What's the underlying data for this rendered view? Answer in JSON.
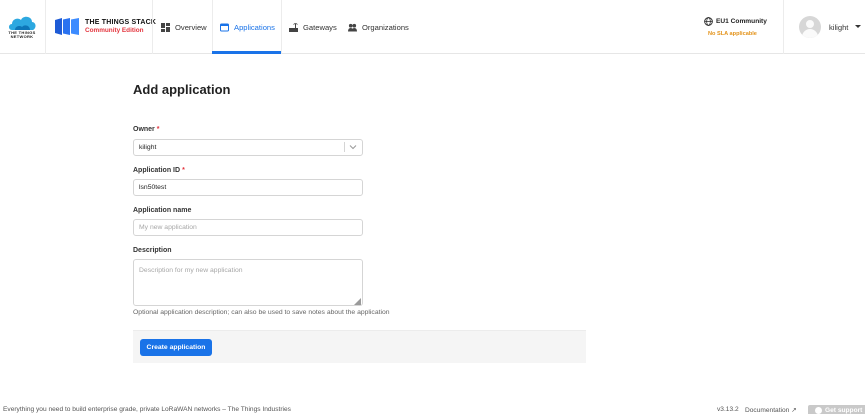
{
  "header": {
    "ttn_logo_text": "THE THINGS NETWORK",
    "stack_title": "THE THINGS STACK",
    "stack_subtitle": "Community Edition",
    "nav": [
      {
        "label": "Overview",
        "icon": "grid-icon",
        "active": false
      },
      {
        "label": "Applications",
        "icon": "window-icon",
        "active": true
      },
      {
        "label": "Gateways",
        "icon": "gateway-icon",
        "active": false
      },
      {
        "label": "Organizations",
        "icon": "people-icon",
        "active": false
      }
    ],
    "cluster": "EU1 Community",
    "sla": "No SLA applicable",
    "username": "kilight"
  },
  "form": {
    "title": "Add application",
    "owner_label": "Owner",
    "owner_value": "kilight",
    "app_id_label": "Application ID",
    "app_id_value": "lsn50test",
    "app_name_label": "Application name",
    "app_name_placeholder": "My new application",
    "description_label": "Description",
    "description_placeholder": "Description for my new application",
    "description_hint": "Optional application description; can also be used to save notes about the application",
    "submit_label": "Create application",
    "required_mark": "*"
  },
  "footer": {
    "tagline": "Everything you need to build enterprise grade, private LoRaWAN networks – The Things Industries",
    "version": "v3.13.2",
    "documentation": "Documentation",
    "support": "Get support"
  },
  "colors": {
    "accent": "#1a73e8",
    "brand_red": "#e3353e",
    "sla_orange": "#e39219"
  }
}
